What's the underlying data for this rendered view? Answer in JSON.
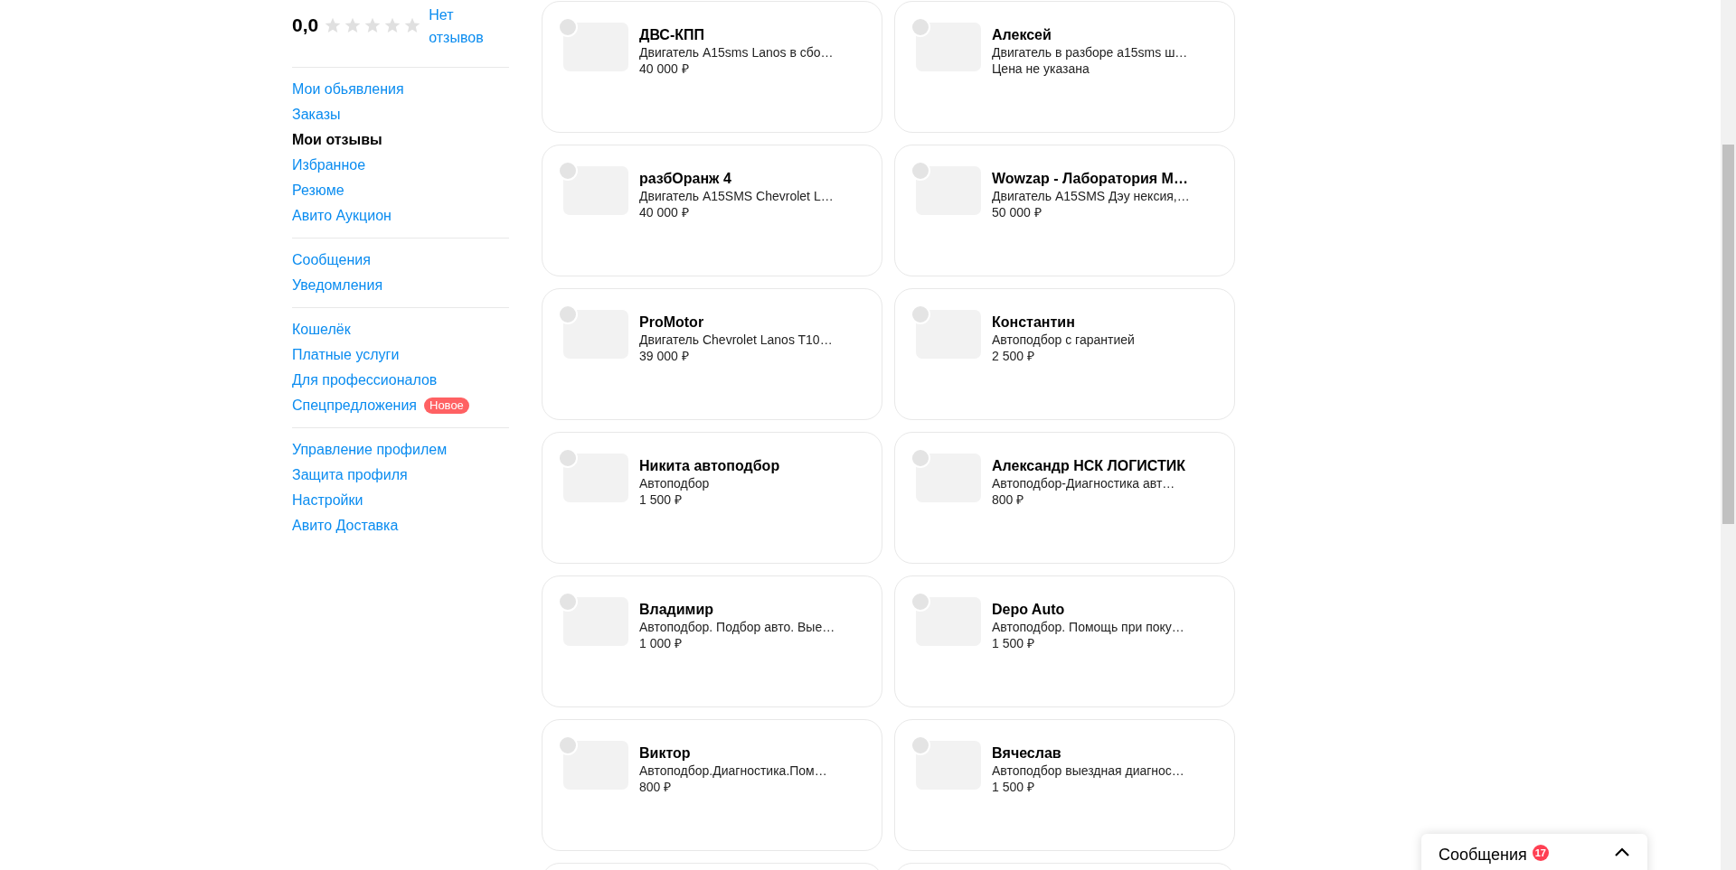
{
  "rating": {
    "value": "0,0",
    "stars": 0,
    "reviews_link": "Нет отзывов"
  },
  "sidebar": {
    "groups": [
      {
        "items": [
          {
            "label": "Мои обьявления",
            "selected": false
          },
          {
            "label": "Заказы",
            "selected": false
          },
          {
            "label": "Мои отзывы",
            "selected": true
          },
          {
            "label": "Избранное",
            "selected": false
          },
          {
            "label": "Резюме",
            "selected": false
          },
          {
            "label": "Авито Аукцион",
            "selected": false
          }
        ]
      },
      {
        "items": [
          {
            "label": "Сообщения",
            "selected": false
          },
          {
            "label": "Уведомления",
            "selected": false
          }
        ]
      },
      {
        "items": [
          {
            "label": "Кошелёк",
            "selected": false
          },
          {
            "label": "Платные услуги",
            "selected": false
          },
          {
            "label": "Для профессионалов",
            "selected": false
          },
          {
            "label": "Спецпредложения",
            "selected": false,
            "badge": "Новое"
          }
        ]
      },
      {
        "items": [
          {
            "label": "Управление профилем",
            "selected": false
          },
          {
            "label": "Защита профиля",
            "selected": false
          },
          {
            "label": "Настройки",
            "selected": false
          },
          {
            "label": "Авито Доставка",
            "selected": false
          }
        ]
      }
    ]
  },
  "cards": [
    {
      "title": "ДВС-КПП",
      "description": "Двигатель A15sms Lanos в сбо…",
      "price": "40 000 ₽"
    },
    {
      "title": "Алексей",
      "description": "Двигатель в разборе a15sms ш…",
      "price": "Цена не указана"
    },
    {
      "title": "разбОранж 4",
      "description": "Двигатель A15SMS Chevrolet L…",
      "price": "40 000 ₽"
    },
    {
      "title": "Wowzap - Лаборатория М…",
      "description": "Двигатель A15SMS Дэу нексия,…",
      "price": "50 000 ₽"
    },
    {
      "title": "ProMotor",
      "description": "Двигатель Chevrolet Lanos T10…",
      "price": "39 000 ₽"
    },
    {
      "title": "Константин",
      "description": "Автоподбор с гарантией",
      "price": "2 500 ₽"
    },
    {
      "title": "Никита автоподбор",
      "description": "Автоподбор",
      "price": "1 500 ₽"
    },
    {
      "title": "Александр НСК ЛОГИСТИК",
      "description": "Автоподбор-Диагностика авт…",
      "price": "800 ₽"
    },
    {
      "title": "Владимир",
      "description": "Автоподбор. Подбор авто. Вые…",
      "price": "1 000 ₽"
    },
    {
      "title": "Depo Auto",
      "description": "Автоподбор. Помощь при поку…",
      "price": "1 500 ₽"
    },
    {
      "title": "Виктор",
      "description": "Автоподбор.Диагностика.Пом…",
      "price": "800 ₽"
    },
    {
      "title": "Вячеслав",
      "description": "Автоподбор выездная диагнос…",
      "price": "1 500 ₽"
    }
  ],
  "chat_widget": {
    "title": "Сообщения",
    "badge": "17"
  }
}
